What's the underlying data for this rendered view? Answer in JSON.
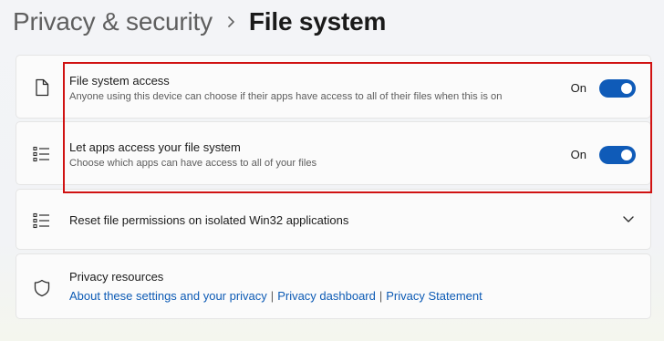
{
  "breadcrumb": {
    "parent": "Privacy & security",
    "current": "File system"
  },
  "settings": [
    {
      "title": "File system access",
      "description": "Anyone using this device can choose if their apps have access to all of their files when this is on",
      "toggle_state": "On",
      "icon": "document-icon"
    },
    {
      "title": "Let apps access your file system",
      "description": "Choose which apps can have access to all of your files",
      "toggle_state": "On",
      "icon": "list-icon"
    }
  ],
  "reset": {
    "title": "Reset file permissions on isolated Win32 applications",
    "icon": "list-icon"
  },
  "privacy_resources": {
    "title": "Privacy resources",
    "icon": "shield-icon",
    "links": [
      "About these settings and your privacy",
      "Privacy dashboard",
      "Privacy Statement"
    ],
    "separator": "|"
  },
  "colors": {
    "accent": "#0f5bb8",
    "link": "#0d5bb5",
    "highlight": "#d01212"
  }
}
